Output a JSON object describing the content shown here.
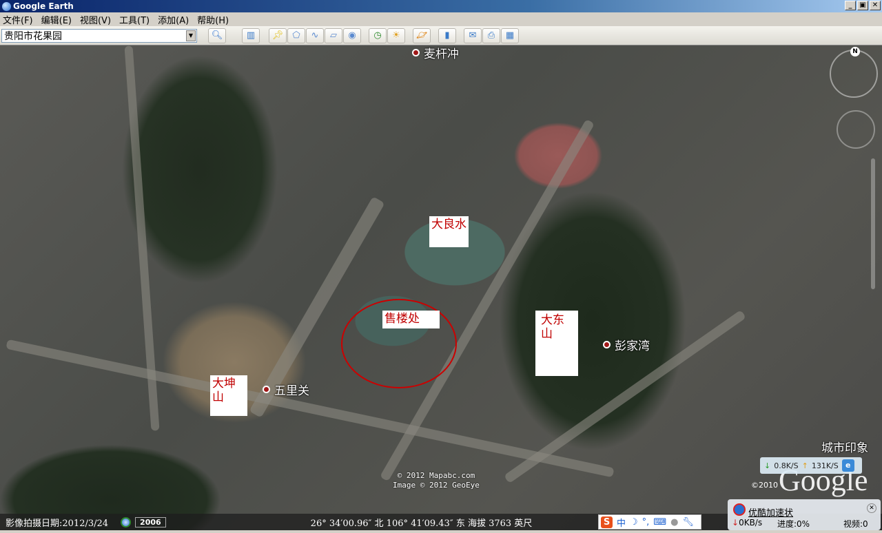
{
  "window": {
    "title": "Google Earth",
    "minimize": "_",
    "restore": "▣",
    "close": "✕"
  },
  "menu": [
    "文件(F)",
    "编辑(E)",
    "视图(V)",
    "工具(T)",
    "添加(A)",
    "帮助(H)"
  ],
  "search": {
    "value": "贵阳市花果园"
  },
  "toolbar": {
    "icons": [
      "sidebar-icon",
      "placemark-icon",
      "polygon-icon",
      "path-icon",
      "overlay-icon",
      "tour-icon",
      "historical-imagery-icon",
      "sunlight-icon",
      "planets-icon",
      "ruler-icon",
      "email-icon",
      "print-icon",
      "maps-icon"
    ]
  },
  "map": {
    "places": [
      {
        "label": "麦杆冲"
      },
      {
        "label": "彭家湾"
      },
      {
        "label": "五里关"
      },
      {
        "label": "城市印象"
      }
    ],
    "notes": [
      {
        "label": "大良水"
      },
      {
        "label": "售楼处"
      },
      {
        "label": "大东山"
      },
      {
        "label": "大坤山"
      }
    ],
    "copyright": [
      "© 2012 Mapabc.com",
      "Image © 2012 GeoEye"
    ],
    "compass_n": "N",
    "google_logo": "Google",
    "google_year": "©2010"
  },
  "status": {
    "date": "影像拍摄日期:2012/3/24",
    "year": "2006",
    "coords": "26° 34′00.96″ 北 106° 41′09.43″ 东 海拔  3763 英尺"
  },
  "ime": {
    "s": "S",
    "mode": "中",
    "moon": "☽",
    "punct": "°,"
  },
  "speed": {
    "down": "0.8K/S",
    "up": "131K/S",
    "ie": "e"
  },
  "youku": {
    "title": "优酷加速状",
    "rate": "0KB/s",
    "progress": "进度:0%",
    "video": "视频:0"
  }
}
